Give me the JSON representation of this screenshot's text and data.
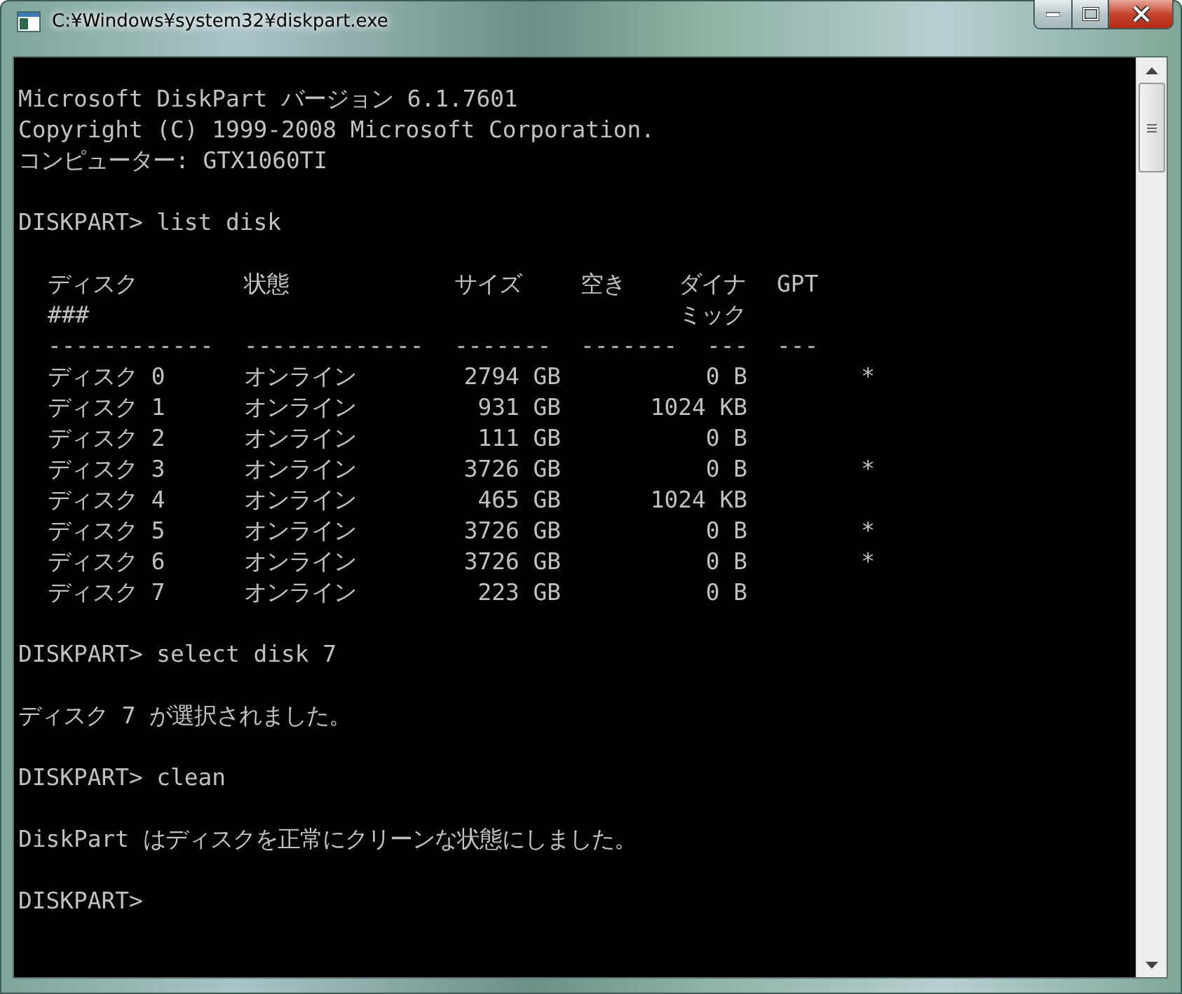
{
  "window": {
    "title": "C:¥Windows¥system32¥diskpart.exe"
  },
  "console": {
    "blocks": [
      {
        "kind": "text",
        "lines": [
          "Microsoft DiskPart バージョン 6.1.7601",
          "Copyright (C) 1999-2008 Microsoft Corporation.",
          "コンピューター: GTX1060TI"
        ]
      },
      {
        "kind": "text",
        "lines": [
          "DISKPART> list disk"
        ]
      },
      {
        "kind": "table",
        "columns": [
          {
            "label": "ディスク",
            "label_2": "###",
            "rule": "------------"
          },
          {
            "label": "状態",
            "rule": "-------------"
          },
          {
            "label": "サイズ",
            "rule": "-------"
          },
          {
            "label": "空き",
            "rule": "-------"
          },
          {
            "label": "ダイナ",
            "label_2": "ミック",
            "rule": "---"
          },
          {
            "label": "GPT",
            "rule": "---"
          }
        ],
        "rows": [
          {
            "disk": "ディスク 0",
            "status": "オンライン",
            "size": "2794 GB",
            "free": "0 B",
            "gpt": "*"
          },
          {
            "disk": "ディスク 1",
            "status": "オンライン",
            "size": "931 GB",
            "free": "1024 KB"
          },
          {
            "disk": "ディスク 2",
            "status": "オンライン",
            "size": "111 GB",
            "free": "0 B"
          },
          {
            "disk": "ディスク 3",
            "status": "オンライン",
            "size": "3726 GB",
            "free": "0 B",
            "gpt": "*"
          },
          {
            "disk": "ディスク 4",
            "status": "オンライン",
            "size": "465 GB",
            "free": "1024 KB"
          },
          {
            "disk": "ディスク 5",
            "status": "オンライン",
            "size": "3726 GB",
            "free": "0 B",
            "gpt": "*"
          },
          {
            "disk": "ディスク 6",
            "status": "オンライン",
            "size": "3726 GB",
            "free": "0 B",
            "gpt": "*"
          },
          {
            "disk": "ディスク 7",
            "status": "オンライン",
            "size": "223 GB",
            "free": "0 B"
          }
        ]
      },
      {
        "kind": "text",
        "lines": [
          "DISKPART> select disk 7"
        ]
      },
      {
        "kind": "text",
        "lines": [
          "ディスク 7 が選択されました。"
        ]
      },
      {
        "kind": "text",
        "lines": [
          "DISKPART> clean"
        ]
      },
      {
        "kind": "text",
        "lines": [
          "DiskPart はディスクを正常にクリーンな状態にしました。"
        ]
      },
      {
        "kind": "text",
        "lines": [
          "DISKPART>"
        ]
      }
    ]
  }
}
